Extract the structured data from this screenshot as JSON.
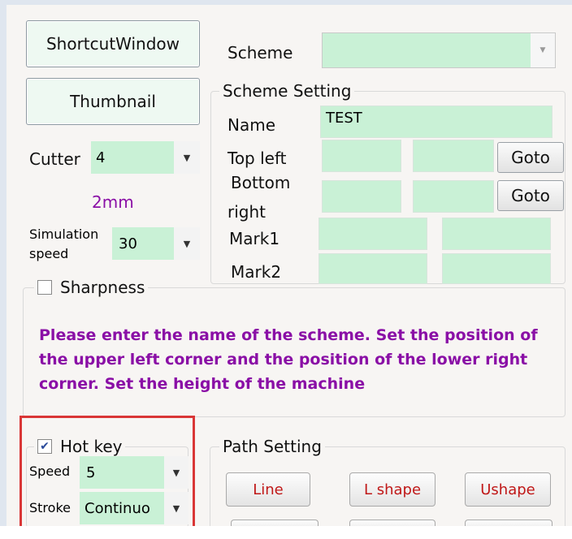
{
  "buttons": {
    "shortcut_window": "ShortcutWindow",
    "thumbnail": "Thumbnail",
    "goto_1": "Goto",
    "goto_2": "Goto"
  },
  "cutter": {
    "label": "Cutter",
    "value": "4",
    "size": "2mm"
  },
  "simulation_speed": {
    "label_line1": "Simulation",
    "label_line2": "speed",
    "value": "30"
  },
  "sharpness": {
    "label": "Sharpness",
    "checked": false
  },
  "scheme": {
    "label": "Scheme",
    "value": ""
  },
  "scheme_setting": {
    "title": "Scheme Setting",
    "name_label": "Name",
    "name_value": "TEST",
    "top_left_label": "Top left",
    "bottom_right_label_1": "Bottom",
    "bottom_right_label_2": "right",
    "mark1_label": "Mark1",
    "mark2_label": "Mark2"
  },
  "message": "Please enter the name of the scheme. Set the position of the upper left corner and the position of the lower right corner. Set the height of the machine",
  "hotkey": {
    "label": "Hot key",
    "checked": true,
    "speed_label": "Speed",
    "speed_value": "5",
    "stroke_label": "Stroke",
    "stroke_value": "Continuo"
  },
  "path_setting": {
    "title": "Path Setting",
    "line": "Line",
    "l_shape": "L shape",
    "u_shape": "Ushape"
  },
  "colors": {
    "field_green": "#c9f1d6",
    "message_purple": "#8a0fa6",
    "highlight_red": "#d93636",
    "path_button_red": "#c01818"
  }
}
